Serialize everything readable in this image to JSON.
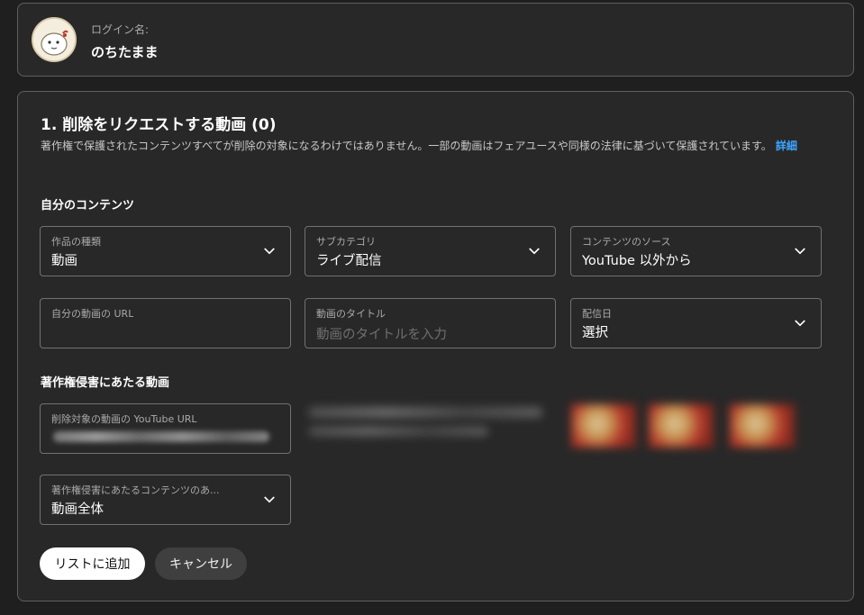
{
  "login": {
    "label": "ログイン名:",
    "name": "のちたまま"
  },
  "request": {
    "title": "1. 削除をリクエストする動画 (0)",
    "description": "著作権で保護されたコンテンツすべてが削除の対象になるわけではありません。一部の動画はフェアユースや同様の法律に基づいて保護されています。",
    "details_link": "詳細",
    "own_content_title": "自分のコンテンツ",
    "fields": {
      "work_type": {
        "label": "作品の種類",
        "value": "動画"
      },
      "subcategory": {
        "label": "サブカテゴリ",
        "value": "ライブ配信"
      },
      "content_source": {
        "label": "コンテンツのソース",
        "value": "YouTube 以外から"
      },
      "own_video_url": {
        "label": "自分の動画の URL",
        "value": ""
      },
      "video_title": {
        "label": "動画のタイトル",
        "placeholder": "動画のタイトルを入力"
      },
      "publish_date": {
        "label": "配信日",
        "value": "選択"
      }
    },
    "infringing_title": "著作権侵害にあたる動画",
    "infringing": {
      "url_field": {
        "label": "削除対象の動画の YouTube URL"
      },
      "content_scope": {
        "label": "著作権侵害にあたるコンテンツのあ...",
        "value": "動画全体"
      }
    },
    "buttons": {
      "add_to_list": "リストに追加",
      "cancel": "キャンセル"
    }
  },
  "icons": {
    "dropdown": "chevron-down-icon"
  },
  "colors": {
    "background": "#1f1f1f",
    "card": "#282828",
    "link": "#3ea6ff",
    "primary_button": "#ffffff",
    "secondary_button": "#3f3f3f"
  }
}
